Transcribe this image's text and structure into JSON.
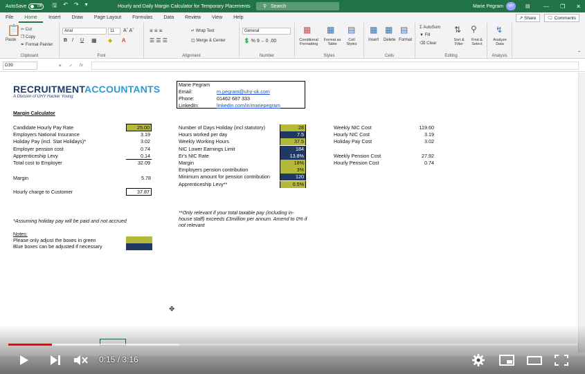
{
  "titlebar": {
    "autosave_label": "AutoSave",
    "autosave_state": "Off",
    "title": "Hourly and Daily Margin Calculator for Temporary Placements",
    "search_placeholder": "Search",
    "user_name": "Marie Pegram",
    "user_initials": "MP"
  },
  "tabs": [
    "File",
    "Home",
    "Insert",
    "Draw",
    "Page Layout",
    "Formulas",
    "Data",
    "Review",
    "View",
    "Help"
  ],
  "active_tab": "Home",
  "share": {
    "share_label": "Share",
    "comments_label": "Comments"
  },
  "ribbon": {
    "clipboard": {
      "paste": "Paste",
      "cut": "Cut",
      "copy": "Copy",
      "format_painter": "Format Painter",
      "label": "Clipboard"
    },
    "font": {
      "name": "Arial",
      "size": "11",
      "label": "Font",
      "bold": "B",
      "italic": "I",
      "underline": "U"
    },
    "alignment": {
      "wrap": "Wrap Text",
      "merge": "Merge & Center",
      "label": "Alignment"
    },
    "number": {
      "format": "General",
      "label": "Number"
    },
    "styles": {
      "conditional": "Conditional Formatting",
      "format_table": "Format as Table",
      "cell_styles": "Cell Styles",
      "label": "Styles"
    },
    "cells": {
      "insert": "Insert",
      "delete": "Delete",
      "format": "Format",
      "label": "Cells"
    },
    "editing": {
      "autosum": "AutoSum",
      "fill": "Fill",
      "clear": "Clear",
      "sort": "Sort & Filter",
      "find": "Find & Select",
      "label": "Editing"
    },
    "analysis": {
      "analyze": "Analyze Data",
      "label": "Analysis"
    }
  },
  "formula_bar": {
    "cell_ref": "D39",
    "fx": "fx"
  },
  "logo": {
    "line1a": "RECRUITMENT",
    "line1b": "ACCOUNTANTS",
    "line2": "A Division of UHY Hacker Young"
  },
  "contact": {
    "name": "Marie Pegram",
    "email_label": "Email:",
    "email": "m.pegram@uhy-uk.com",
    "phone_label": "Phone:",
    "phone": "01462 687 333",
    "linkedin_label": "LinkedIn:",
    "linkedin": "linkedin.com/in/mariepegram"
  },
  "margin_calc": {
    "title": "Margin Calculator",
    "rows": [
      {
        "label": "Candidate Hourly Pay Rate",
        "value": "25.00"
      },
      {
        "label": "Employers National Insurance",
        "value": "3.19"
      },
      {
        "label": "Holiday Pay (incl. Stat Holidays)*",
        "value": "3.02"
      },
      {
        "label": "Employer pension cost",
        "value": "0.74"
      },
      {
        "label": "Apprenticeship Levy",
        "value": "0.14"
      },
      {
        "label": "Total cost to Employer",
        "value": "32.09"
      }
    ],
    "margin_label": "Margin",
    "margin_value": "5.78",
    "hourly_charge_label": "Hourly charge to Customer",
    "hourly_charge_value": "37.87",
    "assumption_note": "*Assuming holiday pay will be paid and not accrued"
  },
  "params": [
    {
      "label": "Number of Days Holiday (incl statutory)",
      "value": "28",
      "style": "green"
    },
    {
      "label": "Hours worked per day",
      "value": "7.5",
      "style": "blue"
    },
    {
      "label": "Weekly Working Hours",
      "value": "37.5",
      "style": "green"
    },
    {
      "label": "NIC Lower Earnings Limit",
      "value": "184",
      "style": "blue"
    },
    {
      "label": "Er's NIC Rate",
      "value": "13.8%",
      "style": "blue"
    },
    {
      "label": "Margin",
      "value": "18%",
      "style": "green"
    },
    {
      "label": "Employers pension contribution",
      "value": "3%",
      "style": "green"
    },
    {
      "label": "Minimum amount for pension contribution",
      "value": "120",
      "style": "blue"
    },
    {
      "label": "Apprenticeship Levy**",
      "value": "0.5%",
      "style": "green"
    }
  ],
  "levy_note": "**Only relevant if your total taxable pay (including in-house staff) exceeds £3million per annum. Amend to 0% if not relevant",
  "weekly": [
    {
      "label": "Weekly NIC Cost",
      "value": "119.60"
    },
    {
      "label": "Hourly NIC Cost",
      "value": "3.19"
    },
    {
      "label": "Holiday Pay Cost",
      "value": "3.02"
    }
  ],
  "pension": [
    {
      "label": "Weekly Pension Cost",
      "value": "27.92"
    },
    {
      "label": "Hourly Pension Cost",
      "value": "0.74"
    }
  ],
  "notes": {
    "title": "Notes:",
    "green_note": "Please only adjust the boxes in green",
    "blue_note": "Blue boxes can be adjusted if necessary"
  },
  "colors": {
    "excel_green": "#217346",
    "input_green": "#b5b93a",
    "input_blue": "#1f3864",
    "progress_red": "#ff0000"
  },
  "video": {
    "current_time": "0:15",
    "duration": "3:16",
    "played_fraction": 0.077,
    "loaded_fraction": 0.3
  }
}
